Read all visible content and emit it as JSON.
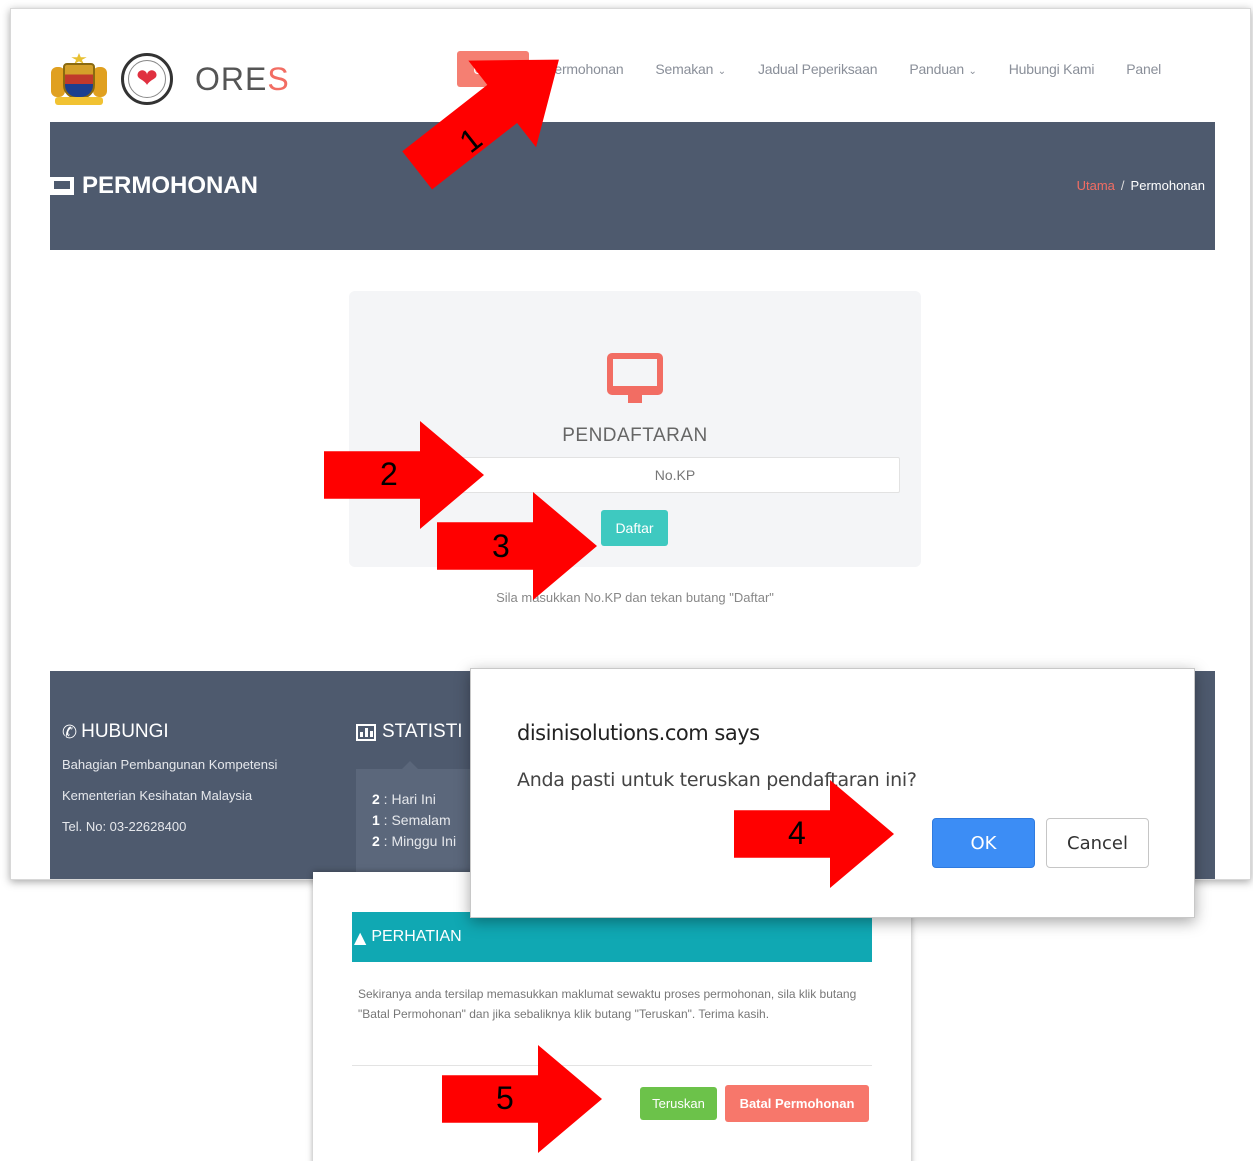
{
  "app": {
    "brand_prefix": "ORE",
    "brand_suffix": "S"
  },
  "nav": {
    "items": [
      {
        "label": "Utama",
        "active": true
      },
      {
        "label": "Permohonan"
      },
      {
        "label": "Semakan",
        "dropdown": true
      },
      {
        "label": "Jadual Peperiksaan"
      },
      {
        "label": "Panduan",
        "dropdown": true
      },
      {
        "label": "Hubungi Kami"
      },
      {
        "label": "Panel"
      }
    ],
    "dropdown_icon": "chevron-down-icon"
  },
  "header": {
    "title": "PERMOHONAN",
    "icon": "desktop-icon",
    "breadcrumb": [
      "Utama",
      "Permohonan"
    ],
    "breadcrumb_separator": "/"
  },
  "registration": {
    "icon": "desktop-icon",
    "title": "PENDAFTARAN",
    "input_placeholder": "No.KP",
    "button_label": "Daftar",
    "hint": "Sila masukkan No.KP dan tekan butang \"Daftar\""
  },
  "footer": {
    "contact_heading": "HUBUNGI",
    "contact_lines": [
      "Bahagian Pembangunan Kompetensi",
      "Kementerian Kesihatan Malaysia",
      "Tel. No: 03-22628400"
    ],
    "stats_heading": "STATISTI",
    "stats": [
      {
        "count": "2",
        "label": "Hari Ini"
      },
      {
        "count": "1",
        "label": "Semalam"
      },
      {
        "count": "2",
        "label": "Minggu Ini"
      }
    ]
  },
  "confirm_dialog": {
    "title": "disinisolutions.com says",
    "message": "Anda pasti untuk teruskan pendaftaran ini?",
    "ok_label": "OK",
    "cancel_label": "Cancel"
  },
  "notice_modal": {
    "heading": "PERHATIAN",
    "icon": "warning-icon",
    "message": "Sekiranya anda tersilap memasukkan maklumat sewaktu proses permohonan, sila klik butang \"Batal Permohonan\" dan jika sebaliknya klik butang \"Teruskan\". Terima kasih.",
    "continue_label": "Teruskan",
    "cancel_label": "Batal Permohonan"
  },
  "annotations": {
    "steps": [
      "1",
      "2",
      "3",
      "4",
      "5"
    ],
    "color": "#ff0000"
  },
  "colors": {
    "accent": "#f26d63",
    "header_bg": "#4e5a6e",
    "teal": "#3ec9c0",
    "alert_teal": "#10a8b3",
    "ok_blue": "#3c8df5",
    "green": "#6cc24a"
  }
}
